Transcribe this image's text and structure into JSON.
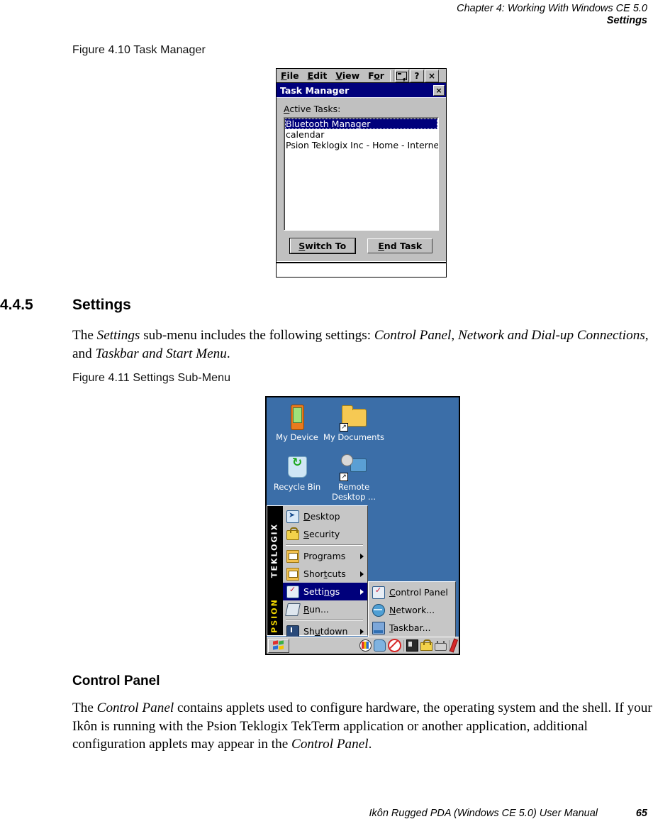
{
  "running_head": {
    "line1": "Chapter 4: Working With Windows CE 5.0",
    "line2": "Settings"
  },
  "figures": {
    "fig_410_caption": "Figure 4.10 Task Manager",
    "fig_411_caption": "Figure 4.11 Settings Sub-Menu"
  },
  "section": {
    "number": "4.4.5",
    "title": "Settings",
    "paragraph_html": "The <i>Settings</i> sub-menu includes the following settings: <i>Control Panel</i>, <i>Network and Dial-up Connections,</i> and <i>Taskbar and Start Menu</i>."
  },
  "subsection": {
    "title": "Control Panel",
    "paragraph_html": "The <i>Control Panel</i> contains applets used to configure hardware, the operating system and the shell. If your Ik&#244;n is running with the Psion Teklogix TekTerm application or another application, additional configuration applets may appear in the <i>Control Panel</i>."
  },
  "task_manager": {
    "menubar": {
      "items": [
        "File",
        "Edit",
        "View",
        "For"
      ],
      "sip_button": "sip-keyboard-icon",
      "help_button": "?",
      "close_button": "×"
    },
    "title": "Task Manager",
    "title_close": "×",
    "active_tasks_label": "Active Tasks:",
    "tasks": [
      {
        "name": "Bluetooth Manager",
        "selected": true
      },
      {
        "name": "calendar",
        "selected": false
      },
      {
        "name": "Psion Teklogix Inc   - Home - Internet",
        "selected": false
      }
    ],
    "buttons": {
      "switch_to": "Switch To",
      "end_task": "End Task"
    }
  },
  "settings_screen": {
    "desktop_color": "#3b6ea8",
    "desktop_icons": [
      {
        "label": "My Device",
        "icon": "device-icon",
        "shortcut": false
      },
      {
        "label": "My Documents",
        "icon": "folder-icon",
        "shortcut": true
      },
      {
        "label": "Recycle Bin",
        "icon": "recycle-bin-icon",
        "shortcut": false
      },
      {
        "label": "Remote Desktop ...",
        "icon": "remote-desktop-icon",
        "shortcut": true
      }
    ],
    "banner": {
      "top_text": "TEKLOGIX",
      "bottom_text": "PSION"
    },
    "start_menu": [
      {
        "label": "Desktop",
        "icon": "desktop-icon",
        "submenu": false,
        "selected": false
      },
      {
        "label": "Security",
        "icon": "lock-icon",
        "submenu": false,
        "selected": false
      },
      {
        "separator": true
      },
      {
        "label": "Programs",
        "icon": "programs-folder-icon",
        "submenu": true,
        "selected": false
      },
      {
        "label": "Shortcuts",
        "icon": "shortcuts-folder-icon",
        "submenu": true,
        "selected": false
      },
      {
        "label": "Settings",
        "icon": "settings-icon",
        "submenu": true,
        "selected": true
      },
      {
        "label": "Run...",
        "icon": "run-icon",
        "submenu": false,
        "selected": false
      },
      {
        "separator": true
      },
      {
        "label": "Shutdown",
        "icon": "shutdown-icon",
        "submenu": true,
        "selected": false
      }
    ],
    "settings_submenu": [
      {
        "label": "Control Panel",
        "icon": "control-panel-icon"
      },
      {
        "label": "Network...",
        "icon": "network-globe-icon"
      },
      {
        "label": "Taskbar...",
        "icon": "taskbar-icon"
      }
    ],
    "taskbar": {
      "start_button": "start-flag-icon",
      "tray_icons": [
        "display-palette-icon",
        "network-cloud-icon",
        "no-connection-icon",
        "sip-panel-icon",
        "lock-icon",
        "power-plug-icon",
        "stylus-pen-icon"
      ]
    }
  },
  "footer": {
    "title": "Ikôn Rugged PDA (Windows CE 5.0) User Manual",
    "page": "65"
  }
}
